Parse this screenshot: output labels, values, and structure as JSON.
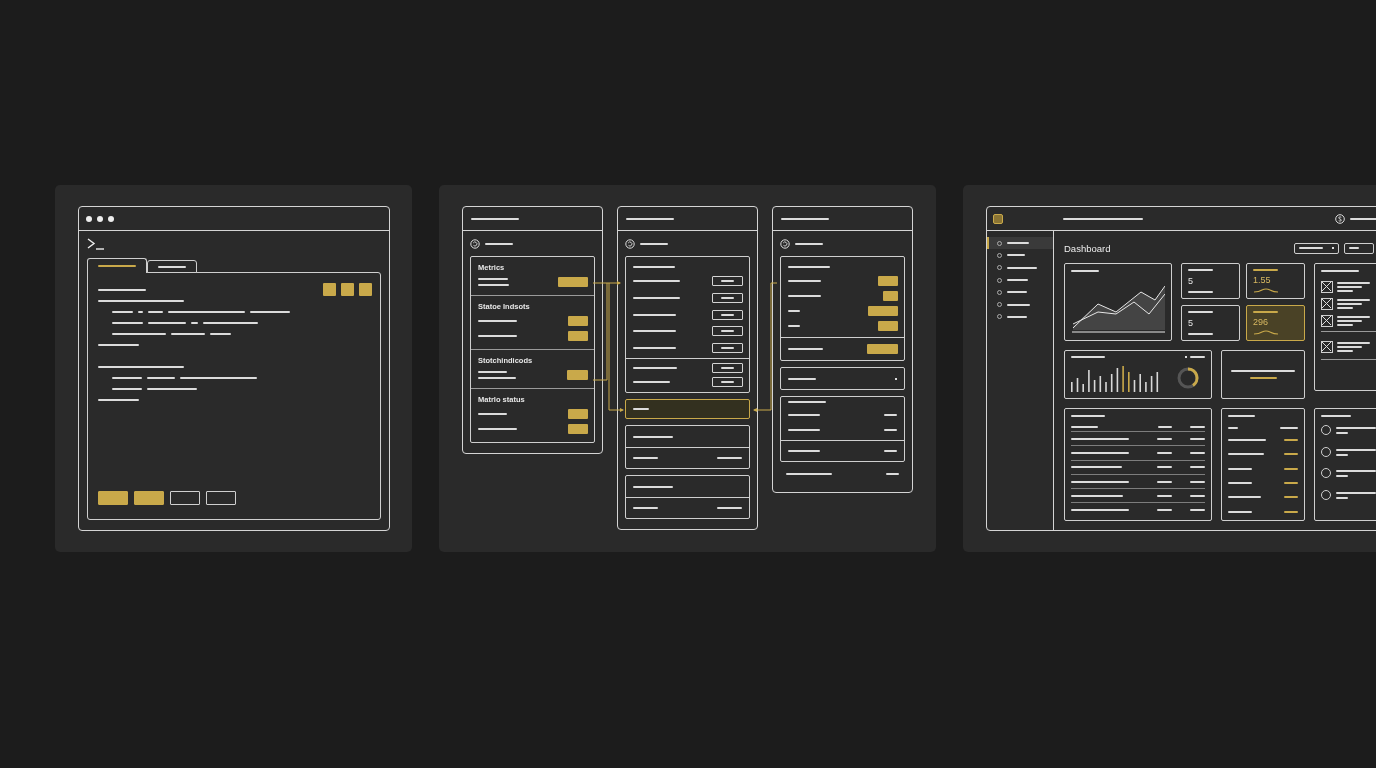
{
  "terminal": {
    "tabs": [
      {
        "selected": true
      },
      {
        "selected": false
      }
    ],
    "actions": [
      {
        "filled": true
      },
      {
        "filled": true
      },
      {
        "filled": false
      },
      {
        "filled": false
      }
    ]
  },
  "flow": {
    "sections": [
      {
        "heading": "Metrics"
      },
      {
        "heading": "Statoe Indsots"
      },
      {
        "heading": "Stotchindicods"
      },
      {
        "heading": "Matrlo status"
      }
    ],
    "cards": [
      {
        "selected": true
      },
      {
        "selected": false
      },
      {
        "selected": false
      }
    ]
  },
  "dashboard": {
    "title": "Dashboard",
    "nav": [
      {
        "selected": true
      },
      {
        "selected": false
      },
      {
        "selected": false
      },
      {
        "selected": false
      },
      {
        "selected": false
      },
      {
        "selected": false
      },
      {
        "selected": false
      }
    ],
    "stats": [
      {
        "value": "5",
        "accent": false,
        "highlighted": false
      },
      {
        "value": "1.55",
        "accent": true,
        "highlighted": false
      },
      {
        "value": "5",
        "accent": false,
        "highlighted": false
      },
      {
        "value": "296",
        "accent": true,
        "highlighted": true
      }
    ],
    "checklist": [
      {
        "checked": true
      },
      {
        "checked": true
      },
      {
        "checked": true
      },
      {
        "checked": true
      }
    ],
    "radios": [
      {
        "selected": false
      },
      {
        "selected": false
      },
      {
        "selected": false
      },
      {
        "selected": false
      }
    ]
  }
}
